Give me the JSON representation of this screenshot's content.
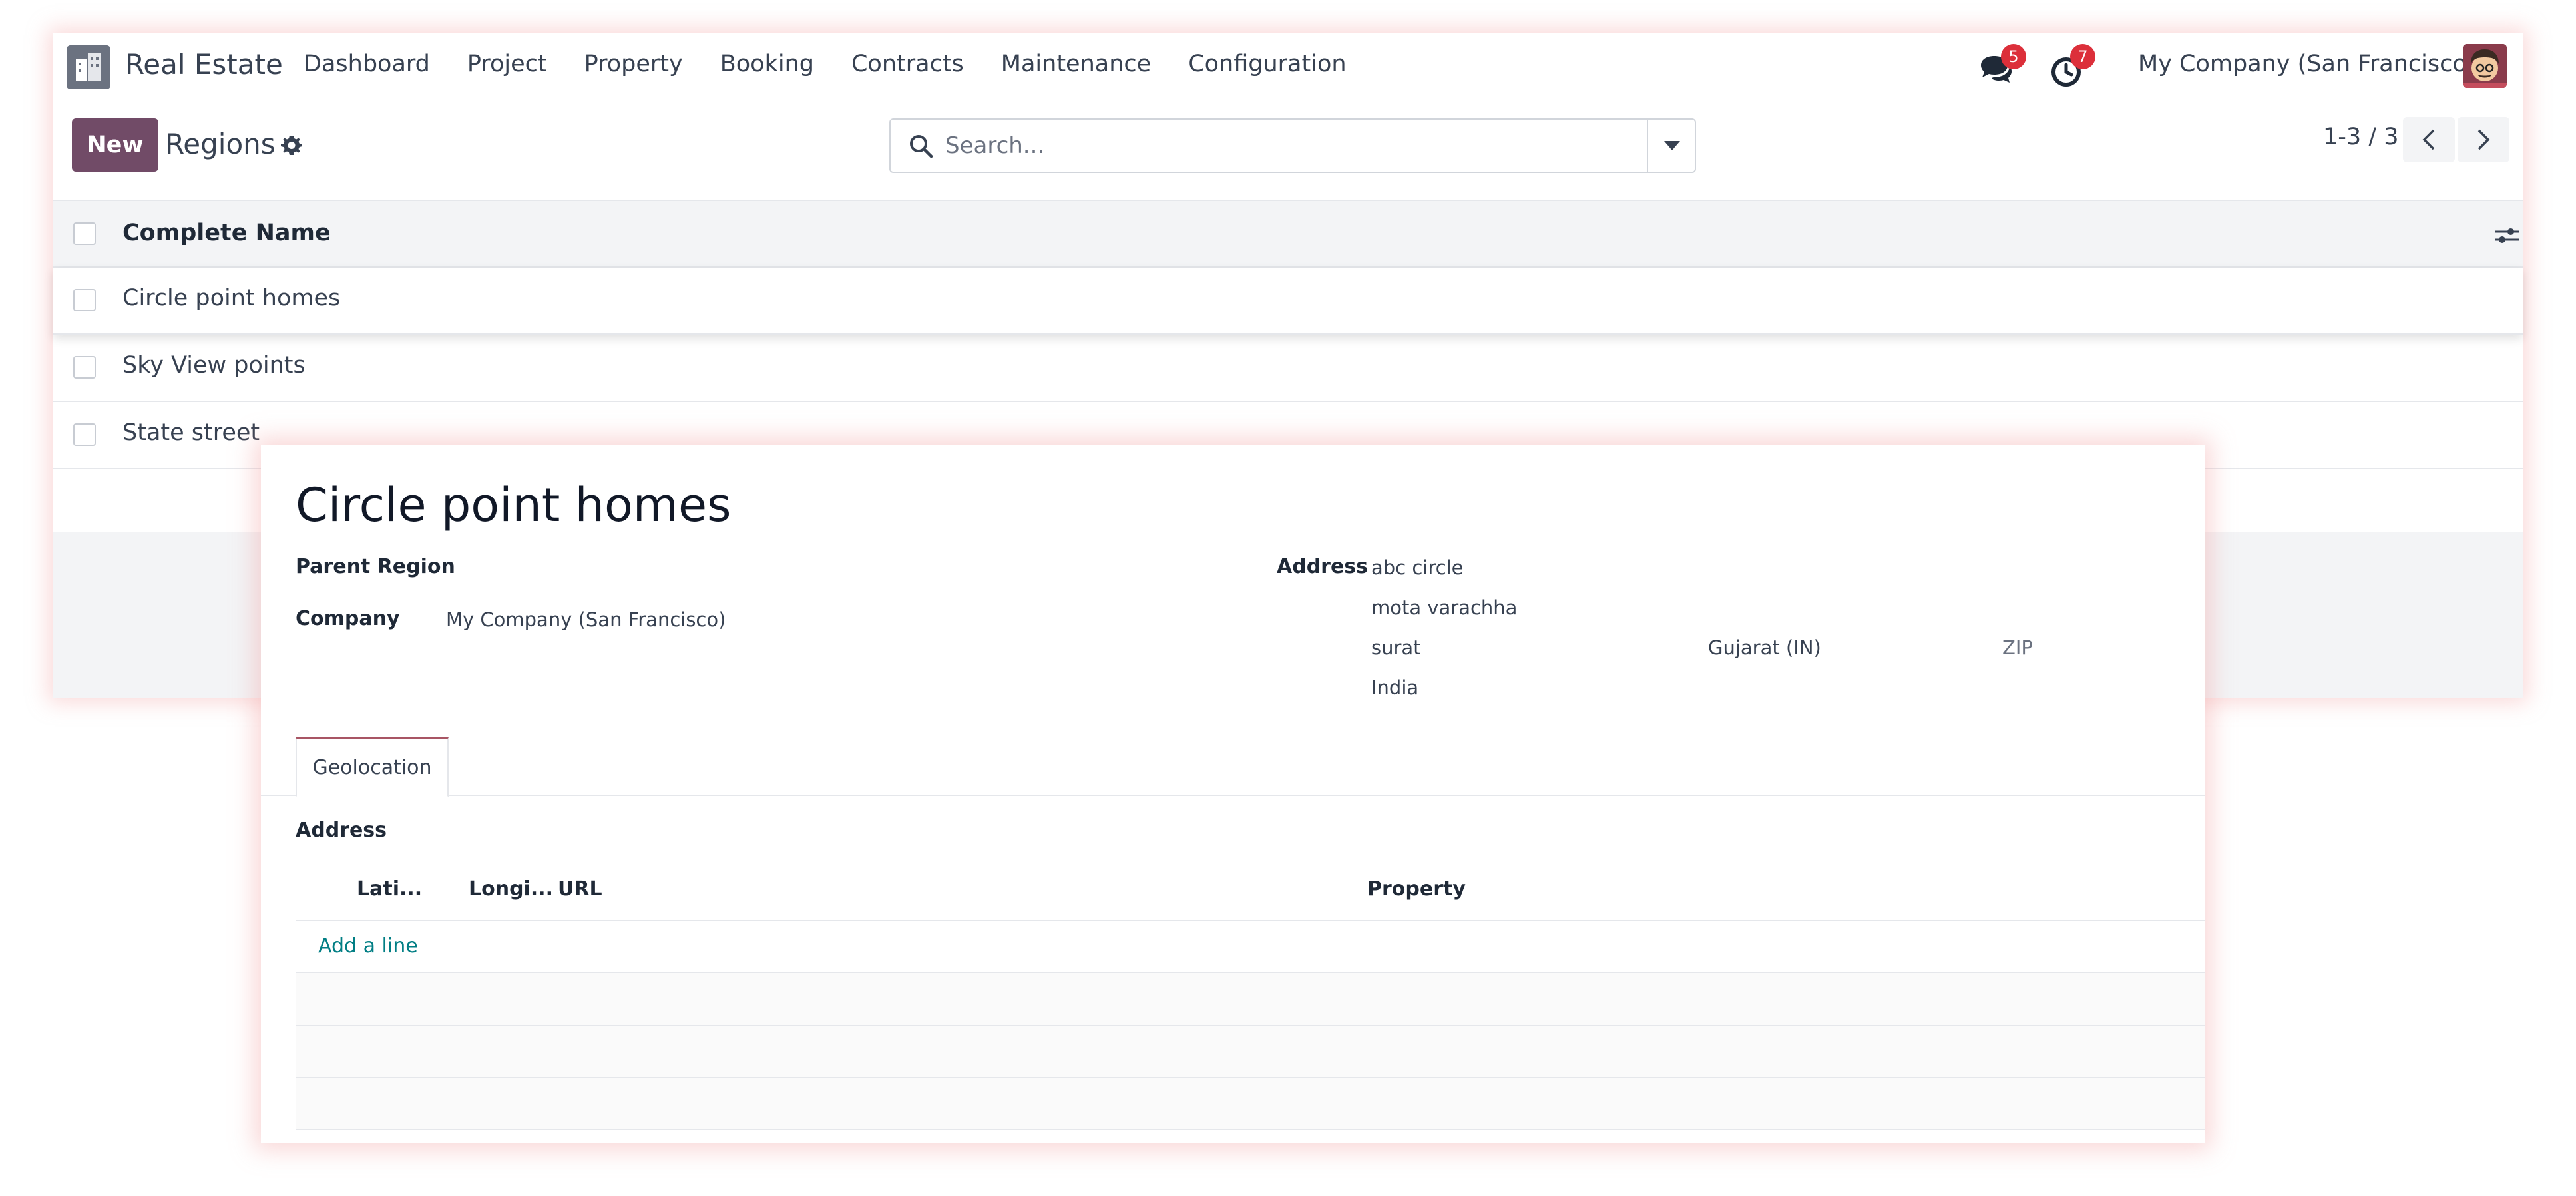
{
  "navbar": {
    "app_name": "Real Estate",
    "menu": [
      "Dashboard",
      "Project",
      "Property",
      "Booking",
      "Contracts",
      "Maintenance",
      "Configuration"
    ],
    "messages_count": "5",
    "activities_count": "7",
    "company": "My Company (San Francisco)"
  },
  "control": {
    "new_label": "New",
    "breadcrumb": "Regions",
    "search_placeholder": "Search...",
    "pager": "1-3 / 3"
  },
  "list": {
    "column": "Complete Name",
    "rows": [
      "Circle point homes",
      "Sky View points",
      "State street"
    ]
  },
  "form": {
    "title": "Circle point homes",
    "parent_region_label": "Parent Region",
    "company_label": "Company",
    "company_value": "My Company (San Francisco)",
    "address_label": "Address",
    "street": "abc circle",
    "street2": "mota varachha",
    "city": "surat",
    "state": "Gujarat (IN)",
    "zip_placeholder": "ZIP",
    "country": "India",
    "tab": "Geolocation",
    "section_label": "Address",
    "columns": [
      "Lati...",
      "Longi...",
      "URL",
      "Property"
    ],
    "add_line": "Add a line"
  },
  "colors": {
    "primary": "#714b67",
    "badge": "#dc2f3a",
    "link": "#017e84"
  },
  "icons": [
    "app-building-icon",
    "chat-icon",
    "clock-icon",
    "gear-icon",
    "search-icon",
    "caret-down-icon",
    "chevron-left-icon",
    "chevron-right-icon",
    "column-options-icon",
    "avatar"
  ]
}
